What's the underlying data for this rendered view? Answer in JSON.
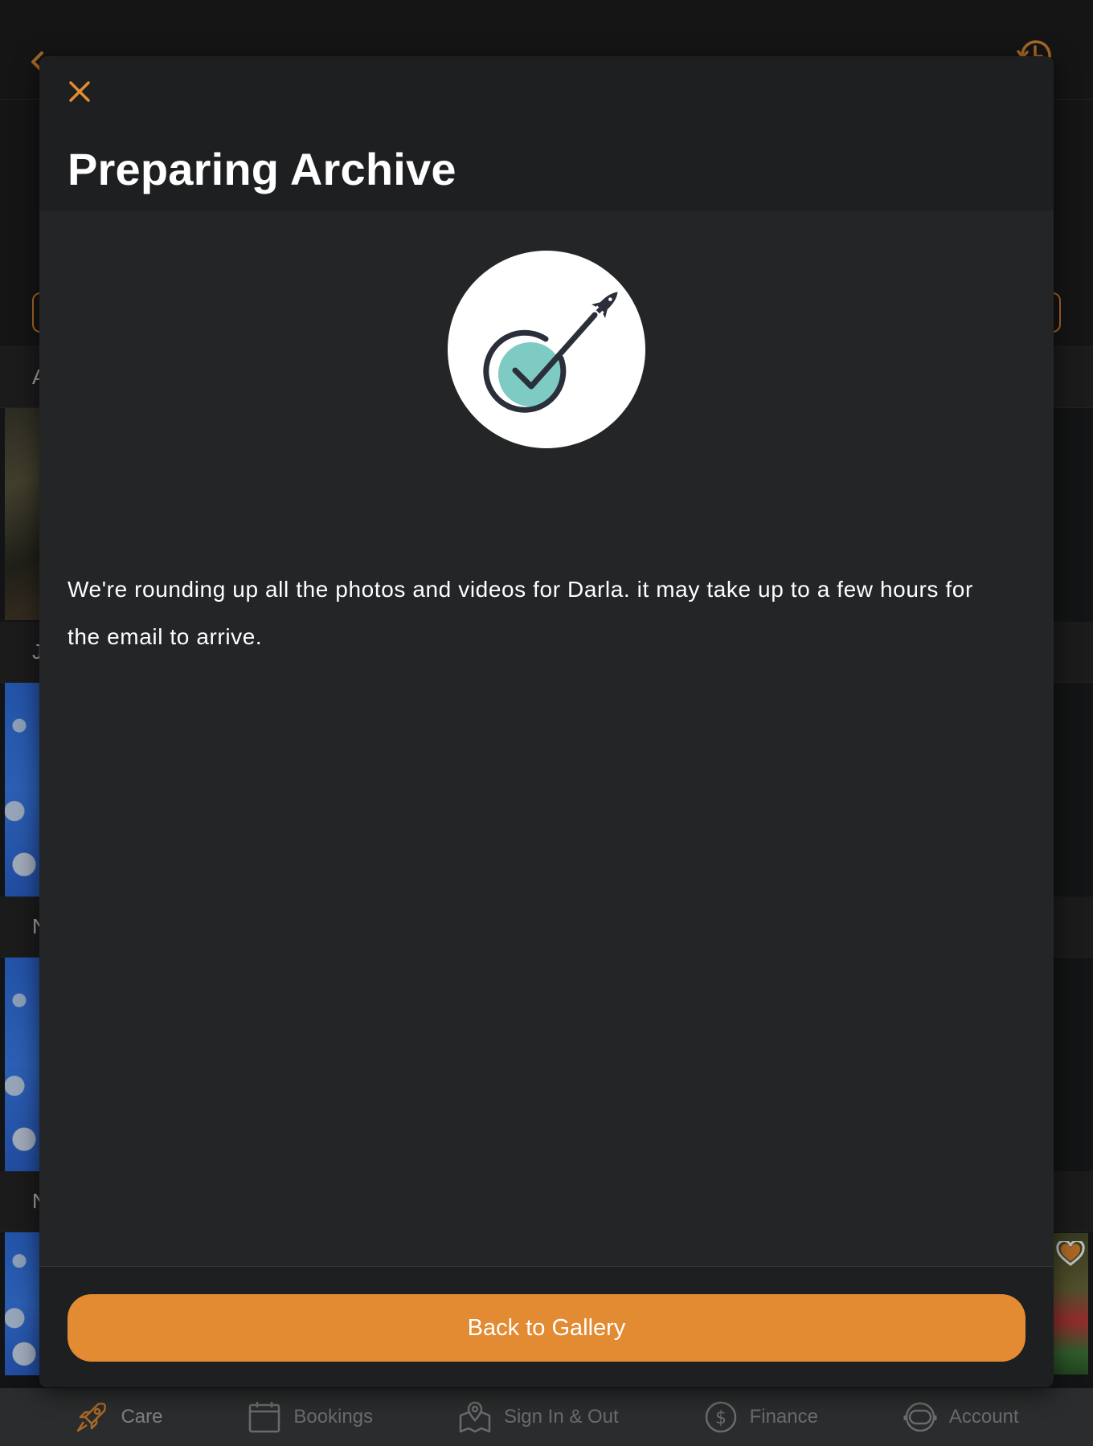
{
  "modal": {
    "title": "Preparing Archive",
    "message": "We're rounding up all the photos and videos for Darla. it may take up to a few hours for the email to arrive.",
    "primary_button_label": "Back to Gallery",
    "close_icon": "close-icon",
    "illustration_icon": "rocket-checkmark-icon"
  },
  "background": {
    "section_headings": [
      "A",
      "J",
      "N",
      "N"
    ]
  },
  "tab_bar": {
    "items": [
      {
        "label": "Care",
        "icon": "rocket-icon",
        "active": true
      },
      {
        "label": "Bookings",
        "icon": "calendar-icon",
        "active": false
      },
      {
        "label": "Sign In & Out",
        "icon": "map-pin-icon",
        "active": false
      },
      {
        "label": "Finance",
        "icon": "dollar-circle-icon",
        "active": false
      },
      {
        "label": "Account",
        "icon": "astronaut-helmet-icon",
        "active": false
      }
    ]
  },
  "colors": {
    "accent": "#e38b33",
    "modal_background": "#232526",
    "illustration_teal": "#7ecbc4",
    "illustration_ink": "#2b2f3a"
  }
}
